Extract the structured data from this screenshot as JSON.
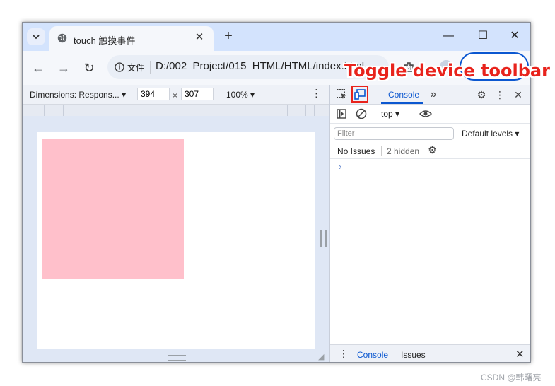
{
  "tab": {
    "title": "touch 触摸事件",
    "close": "✕",
    "new_tab": "+"
  },
  "window": {
    "minimize": "—",
    "maximize": "☐",
    "close": "✕"
  },
  "toolbar": {
    "back": "←",
    "forward": "→",
    "reload": "↻",
    "chip_label": "文件",
    "url": "D:/002_Project/015_HTML/HTML/index.html"
  },
  "device_toolbar": {
    "dimensions_label": "Dimensions: Respons...",
    "width": "394",
    "times": "×",
    "height": "307",
    "zoom": "100%",
    "more": "⋮"
  },
  "devtools": {
    "tabs": {
      "console": "Console",
      "more_tabs": "»"
    },
    "context": "top",
    "filter_placeholder": "Filter",
    "levels": "Default levels",
    "no_issues": "No Issues",
    "hidden": "2 hidden",
    "prompt": "›",
    "drawer": {
      "console": "Console",
      "issues": "Issues",
      "close": "✕",
      "more": "⋮"
    }
  },
  "annotation": "Toggle device toolbar",
  "watermark": "CSDN @韩曙亮",
  "colors": {
    "accent": "#0b57d0",
    "highlight": "#e8231c",
    "pink_box": "#ffc0cb"
  }
}
